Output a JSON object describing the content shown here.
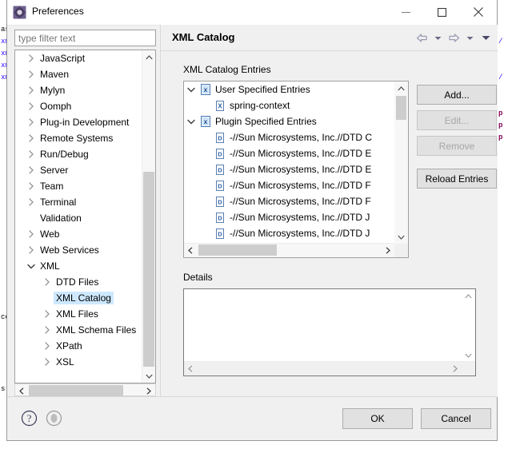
{
  "window": {
    "title": "Preferences",
    "icon": "preferences-gear-icon",
    "controls": {
      "minimize": "minimize-icon",
      "maximize": "maximize-icon",
      "close": "close-icon"
    }
  },
  "sidebar": {
    "filter": {
      "value": "",
      "placeholder": "type filter text"
    },
    "items": [
      {
        "label": "JavaScript",
        "indent": 0,
        "twisty": "collapsed",
        "selected": false
      },
      {
        "label": "Maven",
        "indent": 0,
        "twisty": "collapsed",
        "selected": false
      },
      {
        "label": "Mylyn",
        "indent": 0,
        "twisty": "collapsed",
        "selected": false
      },
      {
        "label": "Oomph",
        "indent": 0,
        "twisty": "collapsed",
        "selected": false
      },
      {
        "label": "Plug-in Development",
        "indent": 0,
        "twisty": "collapsed",
        "selected": false
      },
      {
        "label": "Remote Systems",
        "indent": 0,
        "twisty": "collapsed",
        "selected": false
      },
      {
        "label": "Run/Debug",
        "indent": 0,
        "twisty": "collapsed",
        "selected": false
      },
      {
        "label": "Server",
        "indent": 0,
        "twisty": "collapsed",
        "selected": false
      },
      {
        "label": "Team",
        "indent": 0,
        "twisty": "collapsed",
        "selected": false
      },
      {
        "label": "Terminal",
        "indent": 0,
        "twisty": "collapsed",
        "selected": false
      },
      {
        "label": "Validation",
        "indent": 0,
        "twisty": "none",
        "selected": false
      },
      {
        "label": "Web",
        "indent": 0,
        "twisty": "collapsed",
        "selected": false
      },
      {
        "label": "Web Services",
        "indent": 0,
        "twisty": "collapsed",
        "selected": false
      },
      {
        "label": "XML",
        "indent": 0,
        "twisty": "expanded",
        "selected": false
      },
      {
        "label": "DTD Files",
        "indent": 1,
        "twisty": "collapsed",
        "selected": false
      },
      {
        "label": "XML Catalog",
        "indent": 1,
        "twisty": "none",
        "selected": true
      },
      {
        "label": "XML Files",
        "indent": 1,
        "twisty": "collapsed",
        "selected": false
      },
      {
        "label": "XML Schema Files",
        "indent": 1,
        "twisty": "collapsed",
        "selected": false
      },
      {
        "label": "XPath",
        "indent": 1,
        "twisty": "collapsed",
        "selected": false
      },
      {
        "label": "XSL",
        "indent": 1,
        "twisty": "collapsed",
        "selected": false
      }
    ]
  },
  "page": {
    "title": "XML Catalog",
    "nav": {
      "back": "back-arrow-icon",
      "back_menu": "chevron-down-icon",
      "forward": "forward-arrow-icon",
      "forward_menu": "chevron-down-icon",
      "view_menu": "chevron-down-icon"
    },
    "catalog_group_label": "XML Catalog Entries",
    "catalog_entries": [
      {
        "label": "User Specified Entries",
        "indent": 0,
        "twisty": "expanded",
        "icon": "xml-catalog-icon"
      },
      {
        "label": "spring-context",
        "indent": 1,
        "twisty": "none",
        "icon": "xml-entry-icon"
      },
      {
        "label": "Plugin Specified Entries",
        "indent": 0,
        "twisty": "expanded",
        "icon": "xml-catalog-icon"
      },
      {
        "label": "-//Sun Microsystems, Inc.//DTD C",
        "indent": 1,
        "twisty": "none",
        "icon": "dtd-entry-icon"
      },
      {
        "label": "-//Sun Microsystems, Inc.//DTD E",
        "indent": 1,
        "twisty": "none",
        "icon": "dtd-entry-icon"
      },
      {
        "label": "-//Sun Microsystems, Inc.//DTD E",
        "indent": 1,
        "twisty": "none",
        "icon": "dtd-entry-icon"
      },
      {
        "label": "-//Sun Microsystems, Inc.//DTD F",
        "indent": 1,
        "twisty": "none",
        "icon": "dtd-entry-icon"
      },
      {
        "label": "-//Sun Microsystems, Inc.//DTD F",
        "indent": 1,
        "twisty": "none",
        "icon": "dtd-entry-icon"
      },
      {
        "label": "-//Sun Microsystems, Inc.//DTD J",
        "indent": 1,
        "twisty": "none",
        "icon": "dtd-entry-icon"
      },
      {
        "label": "-//Sun Microsystems, Inc.//DTD J",
        "indent": 1,
        "twisty": "none",
        "icon": "dtd-entry-icon"
      }
    ],
    "buttons": {
      "add": {
        "label": "Add...",
        "enabled": true
      },
      "edit": {
        "label": "Edit...",
        "enabled": false
      },
      "remove": {
        "label": "Remove",
        "enabled": false
      },
      "reload": {
        "label": "Reload Entries",
        "enabled": true
      }
    },
    "details_group_label": "Details",
    "details_text": ""
  },
  "footer": {
    "help_icon": "help-icon",
    "secondary_icon": "apply-icon",
    "ok_label": "OK",
    "cancel_label": "Cancel"
  },
  "colors": {
    "selection": "#cde8ff",
    "dialog_bg": "#f0f0f0",
    "field_bg": "#ffffff",
    "border": "#a0a0a0"
  },
  "background_code": {
    "left_lines": [
      "as",
      "xm",
      "xm",
      "xm",
      "xm",
      "",
      "",
      "",
      "",
      "",
      "",
      "",
      "",
      "",
      "",
      "",
      "",
      "",
      "ce",
      "",
      "",
      "",
      "s"
    ],
    "right_lines": [
      "/",
      "",
      "",
      "/",
      "",
      "p",
      "p",
      "p",
      "",
      "",
      "",
      "",
      "",
      "",
      "",
      "",
      "",
      "",
      "",
      "",
      "",
      "",
      ""
    ]
  }
}
